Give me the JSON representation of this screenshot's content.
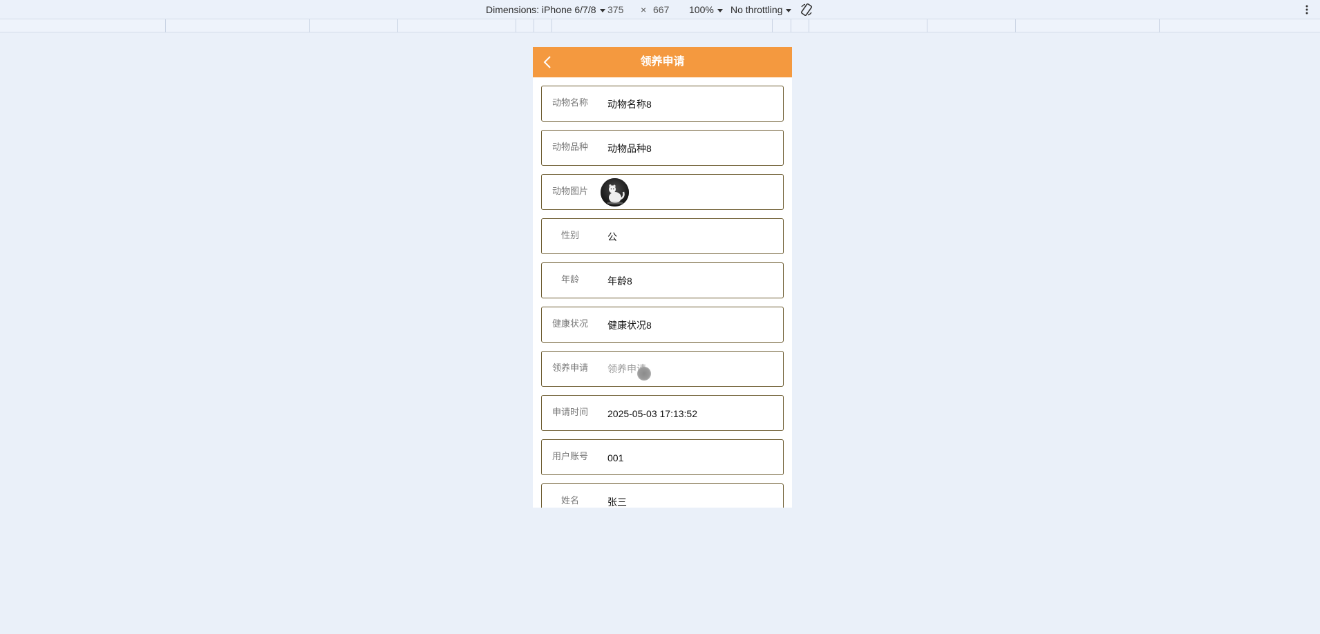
{
  "devtools": {
    "dimensions_label": "Dimensions: iPhone 6/7/8",
    "width": "375",
    "times": "×",
    "height": "667",
    "zoom": "100%",
    "throttling": "No throttling",
    "rotate_icon": "rotate-icon",
    "more_icon": "kebab-menu-icon"
  },
  "app": {
    "header_color": "#f4993f",
    "title": "领养申请",
    "back_icon": "chevron-left-icon"
  },
  "form": {
    "animal_name": {
      "label": "动物名称",
      "value": "动物名称8"
    },
    "animal_breed": {
      "label": "动物品种",
      "value": "动物品种8"
    },
    "animal_image": {
      "label": "动物图片"
    },
    "gender": {
      "label": "性别",
      "value": "公"
    },
    "age": {
      "label": "年龄",
      "value": "年龄8"
    },
    "health": {
      "label": "健康状况",
      "value": "健康状况8"
    },
    "application": {
      "label": "领养申请",
      "placeholder": "领养申请"
    },
    "apply_time": {
      "label": "申请时间",
      "value": "2025-05-03 17:13:52"
    },
    "user_account": {
      "label": "用户账号",
      "value": "001"
    },
    "name": {
      "label": "姓名",
      "value": "张三"
    }
  }
}
